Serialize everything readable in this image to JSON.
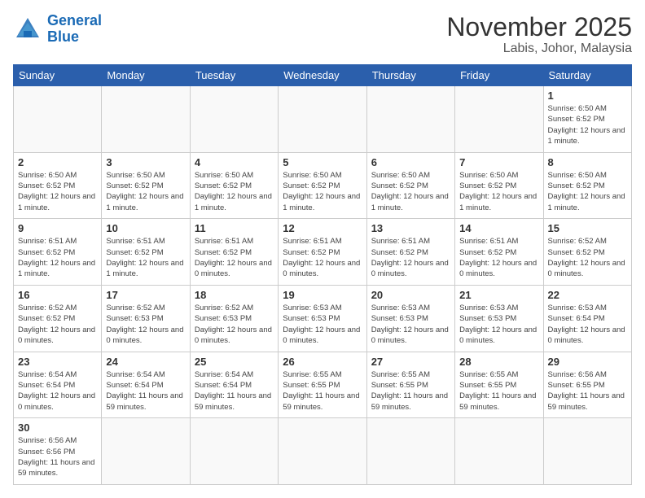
{
  "header": {
    "logo_line1": "General",
    "logo_line2": "Blue",
    "main_title": "November 2025",
    "subtitle": "Labis, Johor, Malaysia"
  },
  "calendar": {
    "days_of_week": [
      "Sunday",
      "Monday",
      "Tuesday",
      "Wednesday",
      "Thursday",
      "Friday",
      "Saturday"
    ],
    "weeks": [
      [
        {
          "day": "",
          "empty": true
        },
        {
          "day": "",
          "empty": true
        },
        {
          "day": "",
          "empty": true
        },
        {
          "day": "",
          "empty": true
        },
        {
          "day": "",
          "empty": true
        },
        {
          "day": "",
          "empty": true
        },
        {
          "day": "1",
          "info": "Sunrise: 6:50 AM\nSunset: 6:52 PM\nDaylight: 12 hours\nand 1 minute."
        }
      ],
      [
        {
          "day": "2",
          "info": "Sunrise: 6:50 AM\nSunset: 6:52 PM\nDaylight: 12 hours\nand 1 minute."
        },
        {
          "day": "3",
          "info": "Sunrise: 6:50 AM\nSunset: 6:52 PM\nDaylight: 12 hours\nand 1 minute."
        },
        {
          "day": "4",
          "info": "Sunrise: 6:50 AM\nSunset: 6:52 PM\nDaylight: 12 hours\nand 1 minute."
        },
        {
          "day": "5",
          "info": "Sunrise: 6:50 AM\nSunset: 6:52 PM\nDaylight: 12 hours\nand 1 minute."
        },
        {
          "day": "6",
          "info": "Sunrise: 6:50 AM\nSunset: 6:52 PM\nDaylight: 12 hours\nand 1 minute."
        },
        {
          "day": "7",
          "info": "Sunrise: 6:50 AM\nSunset: 6:52 PM\nDaylight: 12 hours\nand 1 minute."
        },
        {
          "day": "8",
          "info": "Sunrise: 6:50 AM\nSunset: 6:52 PM\nDaylight: 12 hours\nand 1 minute."
        }
      ],
      [
        {
          "day": "9",
          "info": "Sunrise: 6:51 AM\nSunset: 6:52 PM\nDaylight: 12 hours\nand 1 minute."
        },
        {
          "day": "10",
          "info": "Sunrise: 6:51 AM\nSunset: 6:52 PM\nDaylight: 12 hours\nand 1 minute."
        },
        {
          "day": "11",
          "info": "Sunrise: 6:51 AM\nSunset: 6:52 PM\nDaylight: 12 hours\nand 0 minutes."
        },
        {
          "day": "12",
          "info": "Sunrise: 6:51 AM\nSunset: 6:52 PM\nDaylight: 12 hours\nand 0 minutes."
        },
        {
          "day": "13",
          "info": "Sunrise: 6:51 AM\nSunset: 6:52 PM\nDaylight: 12 hours\nand 0 minutes."
        },
        {
          "day": "14",
          "info": "Sunrise: 6:51 AM\nSunset: 6:52 PM\nDaylight: 12 hours\nand 0 minutes."
        },
        {
          "day": "15",
          "info": "Sunrise: 6:52 AM\nSunset: 6:52 PM\nDaylight: 12 hours\nand 0 minutes."
        }
      ],
      [
        {
          "day": "16",
          "info": "Sunrise: 6:52 AM\nSunset: 6:52 PM\nDaylight: 12 hours\nand 0 minutes."
        },
        {
          "day": "17",
          "info": "Sunrise: 6:52 AM\nSunset: 6:53 PM\nDaylight: 12 hours\nand 0 minutes."
        },
        {
          "day": "18",
          "info": "Sunrise: 6:52 AM\nSunset: 6:53 PM\nDaylight: 12 hours\nand 0 minutes."
        },
        {
          "day": "19",
          "info": "Sunrise: 6:53 AM\nSunset: 6:53 PM\nDaylight: 12 hours\nand 0 minutes."
        },
        {
          "day": "20",
          "info": "Sunrise: 6:53 AM\nSunset: 6:53 PM\nDaylight: 12 hours\nand 0 minutes."
        },
        {
          "day": "21",
          "info": "Sunrise: 6:53 AM\nSunset: 6:53 PM\nDaylight: 12 hours\nand 0 minutes."
        },
        {
          "day": "22",
          "info": "Sunrise: 6:53 AM\nSunset: 6:54 PM\nDaylight: 12 hours\nand 0 minutes."
        }
      ],
      [
        {
          "day": "23",
          "info": "Sunrise: 6:54 AM\nSunset: 6:54 PM\nDaylight: 12 hours\nand 0 minutes."
        },
        {
          "day": "24",
          "info": "Sunrise: 6:54 AM\nSunset: 6:54 PM\nDaylight: 11 hours\nand 59 minutes."
        },
        {
          "day": "25",
          "info": "Sunrise: 6:54 AM\nSunset: 6:54 PM\nDaylight: 11 hours\nand 59 minutes."
        },
        {
          "day": "26",
          "info": "Sunrise: 6:55 AM\nSunset: 6:55 PM\nDaylight: 11 hours\nand 59 minutes."
        },
        {
          "day": "27",
          "info": "Sunrise: 6:55 AM\nSunset: 6:55 PM\nDaylight: 11 hours\nand 59 minutes."
        },
        {
          "day": "28",
          "info": "Sunrise: 6:55 AM\nSunset: 6:55 PM\nDaylight: 11 hours\nand 59 minutes."
        },
        {
          "day": "29",
          "info": "Sunrise: 6:56 AM\nSunset: 6:55 PM\nDaylight: 11 hours\nand 59 minutes."
        }
      ],
      [
        {
          "day": "30",
          "info": "Sunrise: 6:56 AM\nSunset: 6:56 PM\nDaylight: 11 hours\nand 59 minutes."
        },
        {
          "day": "",
          "empty": true
        },
        {
          "day": "",
          "empty": true
        },
        {
          "day": "",
          "empty": true
        },
        {
          "day": "",
          "empty": true
        },
        {
          "day": "",
          "empty": true
        },
        {
          "day": "",
          "empty": true
        }
      ]
    ]
  }
}
